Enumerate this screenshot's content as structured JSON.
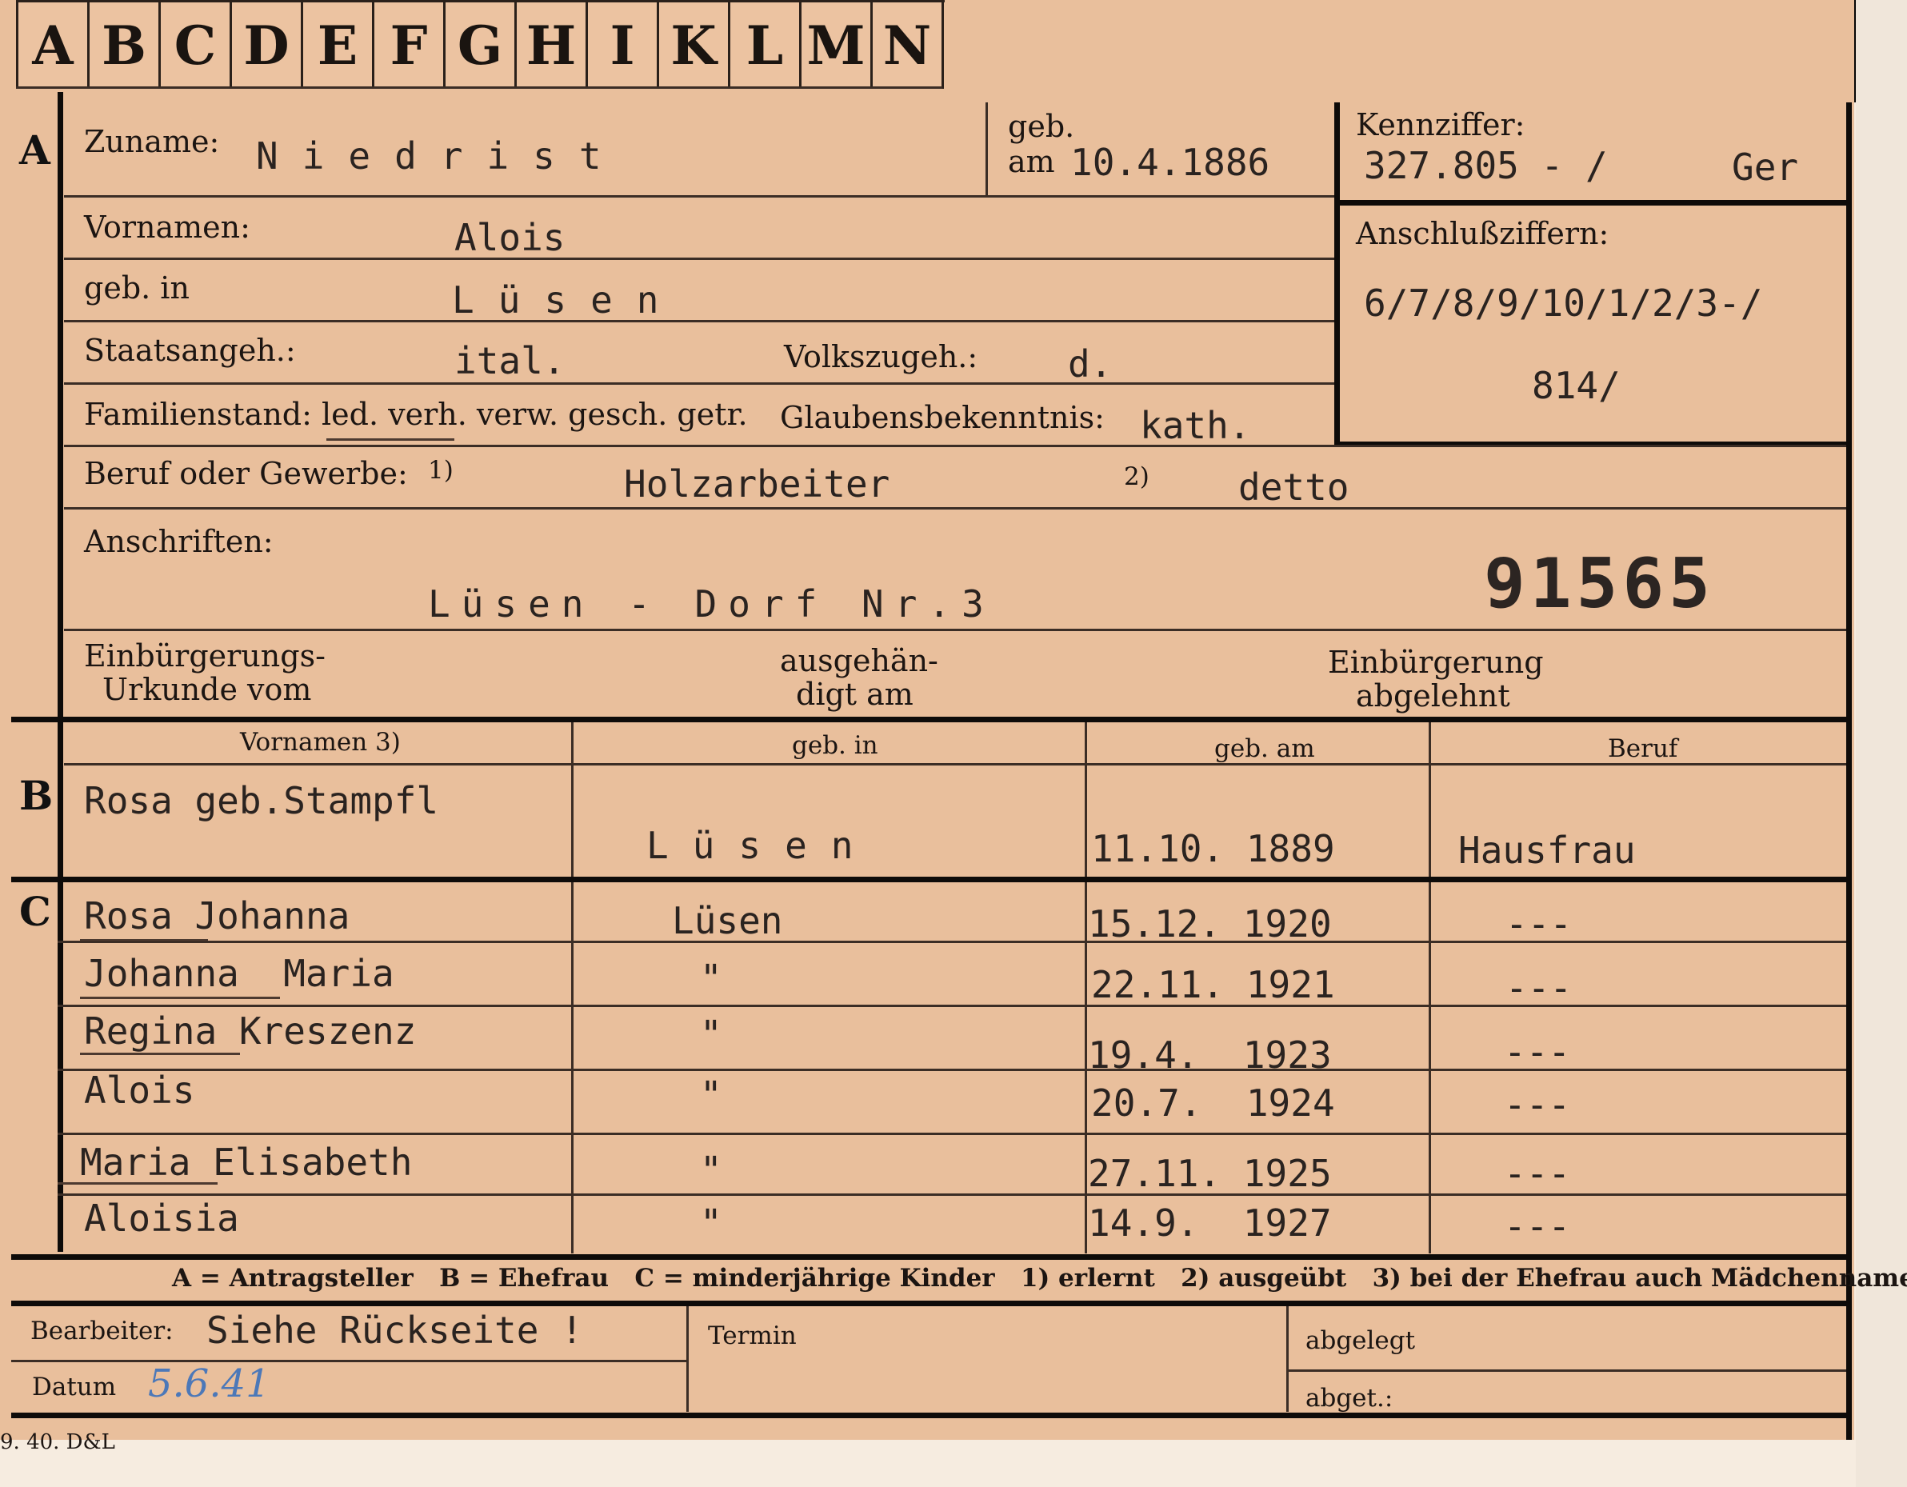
{
  "tabs": [
    "A",
    "B",
    "C",
    "D",
    "E",
    "F",
    "G",
    "H",
    "I",
    "K",
    "L",
    "M",
    "N"
  ],
  "section_markers": {
    "a": "A",
    "b": "B",
    "c": "C"
  },
  "applicant": {
    "zuname_label": "Zuname:",
    "zuname_value": "Niedrist",
    "geb_label_line1": "geb.",
    "geb_label_line2": "am",
    "geb_value": "10.4.1886",
    "vornamen_label": "Vornamen:",
    "vornamen_value": "Alois",
    "geb_in_label": "geb. in",
    "geb_in_value": "Lüsen",
    "staatsangeh_label": "Staatsangeh.:",
    "staatsangeh_value": "ital.",
    "volkszugeh_label": "Volkszugeh.:",
    "volkszugeh_value": "d.",
    "familienstand_label": "Familienstand: led. verh. verw. gesch. getr.",
    "glaubens_label": "Glaubensbekenntnis:",
    "glaubens_value": "kath.",
    "beruf_label": "Beruf oder Gewerbe:",
    "beruf_note1": "1)",
    "beruf_value1": "Holzarbeiter",
    "beruf_note2": "2)",
    "beruf_value2": "detto",
    "anschriften_label": "Anschriften:",
    "anschriften_value": "Lüsen - Dorf Nr.3",
    "stamp_number": "91565",
    "einb_urkunde_label_1": "Einbürgerungs-",
    "einb_urkunde_label_2": "Urkunde vom",
    "ausgehaend_label_1": "ausgehän-",
    "ausgehaend_label_2": "digt am",
    "einb_abgelehnt_label_1": "Einbürgerung",
    "einb_abgelehnt_label_2": "abgelehnt"
  },
  "kennziffer": {
    "label": "Kennziffer:",
    "value": "327.805 - /",
    "suffix": "Ger",
    "anschluss_label": "Anschlußziffern:",
    "anschluss_line1": "6/7/8/9/10/1/2/3-/",
    "anschluss_line2": "814/"
  },
  "spouse_table": {
    "headers": [
      "Vornamen 3)",
      "geb. in",
      "geb. am",
      "Beruf"
    ],
    "row": {
      "vornamen": "Rosa geb.Stampfl",
      "geb_in": "Lüsen",
      "geb_am": "11.10. 1889",
      "beruf": "Hausfrau"
    }
  },
  "children": [
    {
      "name": "Rosa Johanna",
      "geb_in": "Lüsen",
      "geb_am": "15.12. 1920",
      "beruf": "---"
    },
    {
      "name": "Johanna  Maria",
      "geb_in": "\"",
      "geb_am": "22.11. 1921",
      "beruf": "---"
    },
    {
      "name": "Regina Kreszenz",
      "geb_in": "\"",
      "geb_am": "19.4.  1923",
      "beruf": "---"
    },
    {
      "name": "Alois",
      "geb_in": "\"",
      "geb_am": "20.7.  1924",
      "beruf": "---"
    },
    {
      "name": "Maria Elisabeth",
      "geb_in": "\"",
      "geb_am": "27.11. 1925",
      "beruf": "---"
    },
    {
      "name": "Aloisia",
      "geb_in": "\"",
      "geb_am": "14.9.  1927",
      "beruf": "---"
    }
  ],
  "legend": "A = Antragsteller   B = Ehefrau   C = minderjährige Kinder   1) erlernt   2) ausgeübt   3) bei der Ehefrau auch Mädchenname",
  "footer": {
    "bearbeiter_label": "Bearbeiter:",
    "bearbeiter_value": "Siehe Rückseite !",
    "datum_label": "Datum",
    "datum_value": "5.6.41",
    "termin_label": "Termin",
    "abgelegt_label": "abgelegt",
    "abget_label": "abget.:",
    "print_code": "9. 40. D&L"
  }
}
